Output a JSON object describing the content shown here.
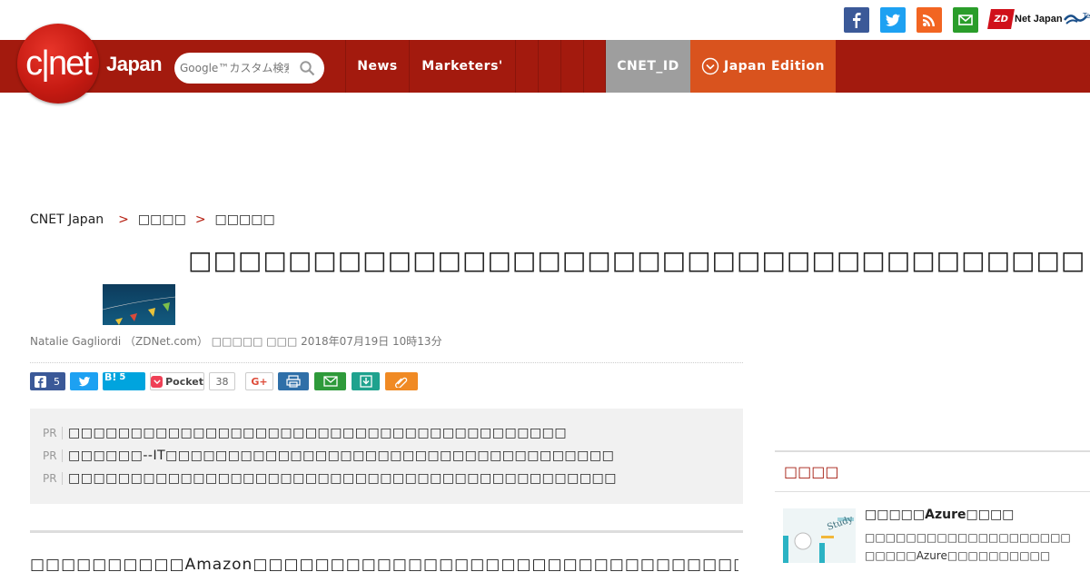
{
  "social": {
    "icons": [
      "facebook-icon",
      "twitter-icon",
      "rss-icon",
      "mail-icon"
    ],
    "zdnet_badge": "ZD",
    "zdnet_label": "Net Japan"
  },
  "logo": {
    "mark": "c|net",
    "region": "Japan"
  },
  "search": {
    "placeholder": "Google™カスタム検索"
  },
  "nav": {
    "news": "News",
    "marketers": "Marketers'",
    "cnet_id": "CNET_ID",
    "edition": "Japan Edition"
  },
  "breadcrumb": {
    "home": "CNET Japan",
    "sep": ">",
    "level1": "□□□□",
    "level2": "□□□□□"
  },
  "article": {
    "headline": "□□□□□□□□□□□□□□□□□□□□□□□□□□□□□□□□□□□□",
    "byline": "Natalie Gagliordi （ZDNet.com） □□□□□ □□□ 2018年07月19日 10時13分"
  },
  "share": {
    "facebook_count": "5",
    "hatena_label": "B!",
    "hatena_count": "5",
    "pocket_label": "Pocket",
    "pocket_count": "38",
    "gplus_label": "G+"
  },
  "pr": {
    "tag": "PR",
    "items": [
      "□□□□□□□□□□□□□□□□□□□□□□□□□□□□□□□□□□□□□□□□",
      "□□□□□□--IT□□□□□□□□□□□□□□□□□□□□□□□□□□□□□□□□□□□□",
      "□□□□□□□□□□□□□□□□□□□□□□□□□□□□□□□□□□□□□□□□□□□□"
    ]
  },
  "body": {
    "first_line": "□□□□□□□□□□Amazon□□□□□□□□□□□□□□□□□□□□□□□□□□□□□□□□□□□□□□□□□□□□□□"
  },
  "sidebar": {
    "heading": "□□□□",
    "item_title": "□□□□□Azure□□□□",
    "item_desc_1": "□□□□□□□□□□□□□□□□□□□□",
    "item_desc_2": "□□□□□Azure□□□□□□□□□□"
  },
  "colors": {
    "brand_red": "#a31a0e",
    "cnet_id_gray": "#9e9e9e",
    "edition_orange": "#d9531e"
  }
}
